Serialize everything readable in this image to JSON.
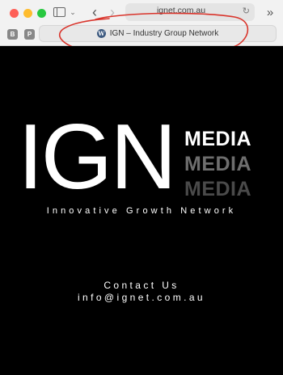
{
  "browser": {
    "url": "ignet.com.au",
    "tab_title": "IGN – Industry Group Network",
    "extensions": [
      "B",
      "P"
    ],
    "icons": {
      "sidebar": "sidebar-icon",
      "back": "chevron-left-icon",
      "forward": "chevron-right-icon",
      "reload": "reload-icon",
      "more": "double-chevron-right-icon",
      "favicon": "wordpress-icon"
    },
    "glyphs": {
      "back": "‹",
      "forward": "›",
      "reload": "↻",
      "more": "»",
      "chevron_down": "⌄",
      "favicon": "W"
    },
    "annotation_color": "#d9342b"
  },
  "page": {
    "logo_main": "IGN",
    "logo_media": [
      "MEDIA",
      "MEDIA",
      "MEDIA"
    ],
    "tagline": "Innovative Growth Network",
    "contact_heading": "Contact Us",
    "contact_email": "info@ignet.com.au",
    "colors": {
      "background": "#000000",
      "text": "#ffffff",
      "media_dim1": "#6e6e6e",
      "media_dim2": "#4a4a4a"
    }
  }
}
